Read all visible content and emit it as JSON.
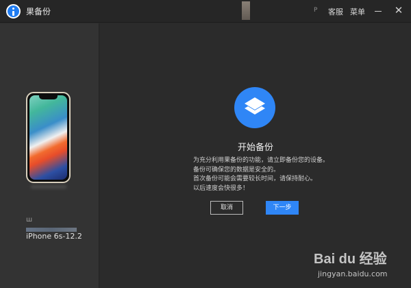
{
  "titlebar": {
    "app_title": "果备份",
    "small_mark": "P",
    "support_label": "客服",
    "menu_label": "菜单",
    "minimize_icon": "minimize-icon",
    "close_symbol": "✕"
  },
  "sidebar": {
    "device_sub": "ш",
    "device_name": "iPhone 6s-12.2"
  },
  "main": {
    "heading": "开始备份",
    "description": [
      "为充分利用果备份的功能，请立即备份您的设备。",
      "备份可确保您的数据是安全的。",
      "首次备份可能会需要较长时间，请保持耐心。",
      "以后速度会快很多！"
    ],
    "cancel_label": "取消",
    "next_label": "下一步"
  },
  "watermark": {
    "brand": "Bai du 经验",
    "url": "jingyan.baidu.com"
  },
  "colors": {
    "accent": "#2f86f6",
    "background": "#2b2b2b",
    "sidebar": "#333333"
  }
}
